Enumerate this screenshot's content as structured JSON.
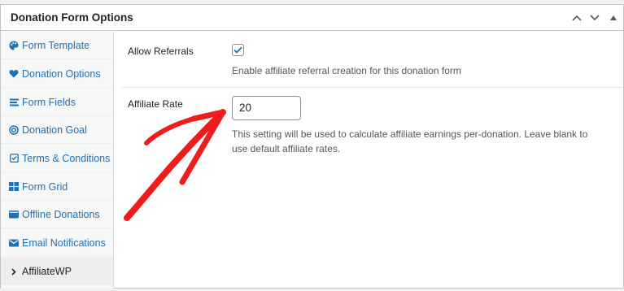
{
  "panel": {
    "title": "Donation Form Options"
  },
  "sidebar": {
    "items": [
      {
        "label": "Form Template",
        "icon": "palette-icon"
      },
      {
        "label": "Donation Options",
        "icon": "heart-icon"
      },
      {
        "label": "Form Fields",
        "icon": "list-icon"
      },
      {
        "label": "Donation Goal",
        "icon": "target-icon"
      },
      {
        "label": "Terms & Conditions",
        "icon": "checkbox-icon"
      },
      {
        "label": "Form Grid",
        "icon": "grid-icon"
      },
      {
        "label": "Offline Donations",
        "icon": "wallet-icon"
      },
      {
        "label": "Email Notifications",
        "icon": "envelope-icon"
      },
      {
        "label": "AffiliateWP",
        "icon": "chevron-right-icon",
        "active": true
      }
    ]
  },
  "fields": {
    "allow_referrals": {
      "label": "Allow Referrals",
      "checked": true,
      "description": "Enable affiliate referral creation for this donation form"
    },
    "affiliate_rate": {
      "label": "Affiliate Rate",
      "value": "20",
      "description": "This setting will be used to calculate affiliate earnings per-donation. Leave blank to use default affiliate rates."
    }
  },
  "colors": {
    "link": "#2271b1",
    "arrow": "#ee1c1c",
    "checkmark": "#2271b1"
  }
}
